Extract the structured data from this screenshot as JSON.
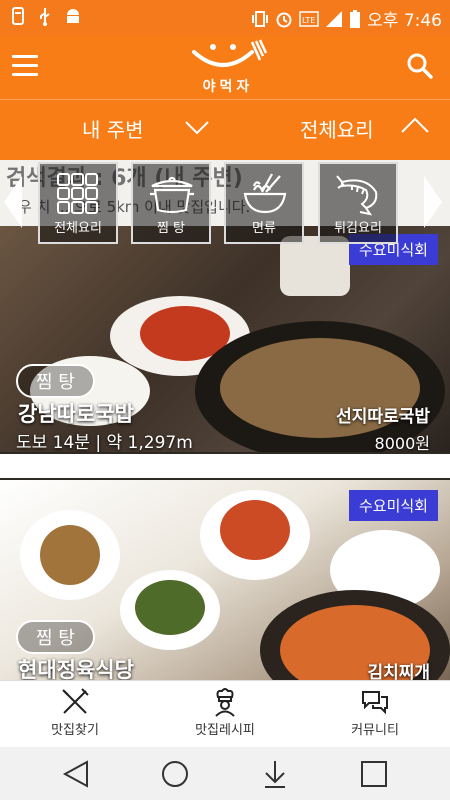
{
  "status_bar": {
    "time": "오후 7:46",
    "icons": [
      "phone-icon",
      "usb-icon",
      "android-icon",
      "vibrate-icon",
      "alarm-icon",
      "lte-icon",
      "signal-icon",
      "battery-icon"
    ]
  },
  "header": {
    "logo_text": "야먹자",
    "colors": {
      "primary": "#f97d16"
    }
  },
  "filters": {
    "location": "내 주변",
    "category": "전체요리"
  },
  "results": {
    "title": "검색결과 : 6개 (내 주변)",
    "subtitle": "우 치 ... 으로 5km 이내 맛집입니다."
  },
  "categories": [
    {
      "label": "전체요리",
      "icon": "grid-icon"
    },
    {
      "label": "찜 탕",
      "icon": "pot-icon"
    },
    {
      "label": "면류",
      "icon": "noodle-icon"
    },
    {
      "label": "튀김요리",
      "icon": "shrimp-icon"
    }
  ],
  "cards": [
    {
      "badge": "수요미식회",
      "tag": "찜 탕",
      "name": "강남따로국밥",
      "distance": "도보 14분 | 약 1,297m",
      "dish": "선지따로국밥",
      "price": "8000원"
    },
    {
      "badge": "수요미식회",
      "tag": "찜 탕",
      "name": "현대정육식당",
      "dish": "김치찌개"
    }
  ],
  "bottom_nav": [
    {
      "label": "맛집찾기",
      "icon": "fork-knife-icon"
    },
    {
      "label": "맛집레시피",
      "icon": "chef-icon"
    },
    {
      "label": "커뮤니티",
      "icon": "chat-icon"
    }
  ]
}
